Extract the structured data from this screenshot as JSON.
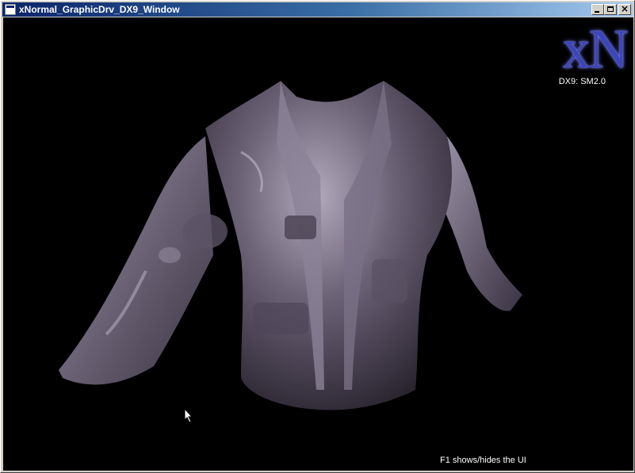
{
  "window": {
    "title": "xNormal_GraphicDrv_DX9_Window",
    "buttons": [
      "minimize",
      "maximize",
      "close"
    ],
    "close_glyph": "×"
  },
  "viewport": {
    "background": "#000000",
    "logo_text": "xN",
    "logo_color": "#3d46b8",
    "renderer_label": "DX9: SM2.0",
    "hint_text": "F1 shows/hides the UI",
    "model": "jacket-mesh",
    "model_color": "#6b6276"
  },
  "icons": {
    "app_icon": "window-icon",
    "cursor": "mouse-cursor-icon"
  }
}
